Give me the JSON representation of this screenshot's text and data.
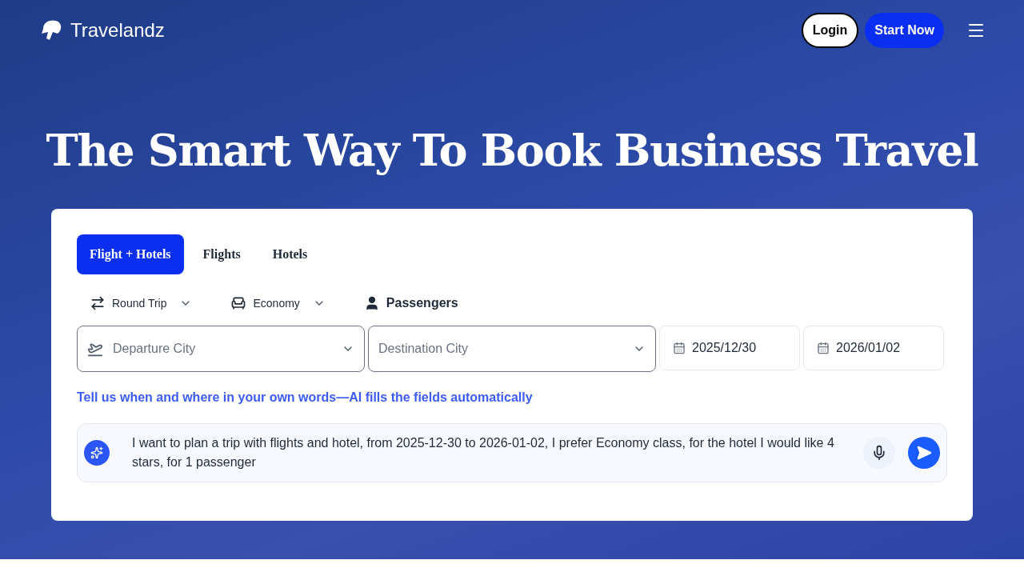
{
  "header": {
    "logo_text": "Travelandz",
    "buttons": [
      {
        "label": "Login",
        "kind": "outline"
      },
      {
        "label": "Start Now",
        "kind": "primary"
      }
    ]
  },
  "hero": {
    "title": "The Smart Way To Book Business Travel"
  },
  "search": {
    "tabs": [
      {
        "label": "Flight + Hotels",
        "selected": true
      },
      {
        "label": "Flights",
        "selected": false
      },
      {
        "label": "Hotels",
        "selected": false
      }
    ],
    "options": [
      {
        "kind": "trip",
        "label": "Round Trip",
        "dropdown": true
      },
      {
        "kind": "cabin",
        "label": "Economy",
        "dropdown": true
      },
      {
        "kind": "passengers",
        "label": "Passengers",
        "dropdown": false
      }
    ],
    "fields": [
      {
        "kind": "departure",
        "placeholder": "Departure City"
      },
      {
        "kind": "destination",
        "placeholder": "Destination City"
      },
      {
        "kind": "date",
        "value": "2025/12/30"
      },
      {
        "kind": "date",
        "value": "2026/01/02"
      }
    ],
    "hint": "Tell us when and where in your own words—AI fills the fields automatically",
    "prompt": {
      "value": "I want to plan a trip with flights and hotel, from 2025-12-30 to 2026-01-02, I prefer Economy class, for the hotel I would like 4 stars, for 1 passenger"
    }
  }
}
